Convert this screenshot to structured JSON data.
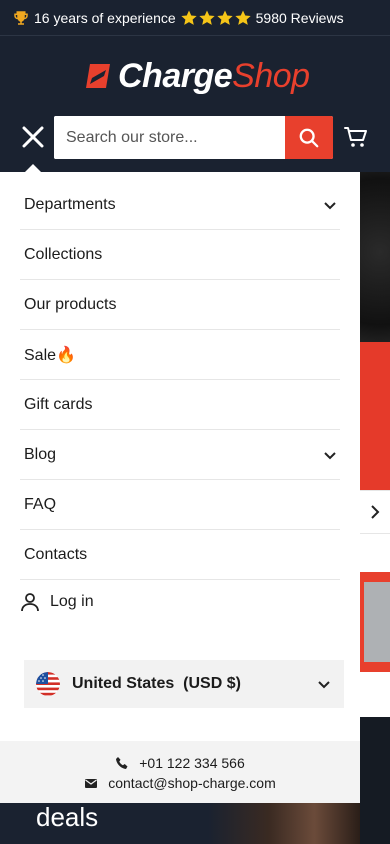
{
  "announcement": {
    "experience_text": "16 years of experience",
    "reviews_text": "5980 Reviews",
    "star_count": 4,
    "star_color": "#f5c518"
  },
  "header": {
    "logo_primary": "Charge",
    "logo_secondary": "Shop",
    "brand_color": "#e8402d",
    "background_color": "#1a2230",
    "search_placeholder": "Search our store..."
  },
  "menu": {
    "items": [
      {
        "label": "Departments",
        "has_submenu": true
      },
      {
        "label": "Collections",
        "has_submenu": false
      },
      {
        "label": "Our products",
        "has_submenu": false
      },
      {
        "label": "Sale🔥",
        "has_submenu": false
      },
      {
        "label": "Gift cards",
        "has_submenu": false
      },
      {
        "label": "Blog",
        "has_submenu": true
      },
      {
        "label": "FAQ",
        "has_submenu": false
      },
      {
        "label": "Contacts",
        "has_submenu": false
      }
    ],
    "login_label": "Log in",
    "country_label": "United States  (USD $)"
  },
  "contact": {
    "phone": "+01 122 334 566",
    "email": "contact@shop-charge.com"
  },
  "background_page": {
    "banner_text": "deals"
  }
}
